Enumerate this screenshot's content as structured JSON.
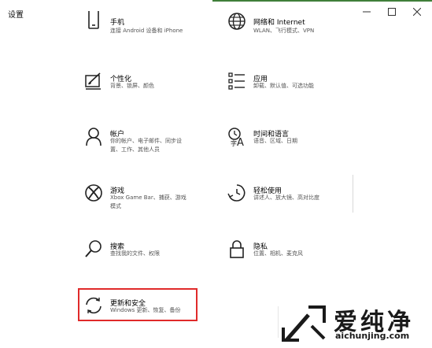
{
  "window": {
    "title": "设置"
  },
  "colors": {
    "highlight_border": "#e02a2a",
    "top_accent": "#3f7f3a"
  },
  "tiles": [
    {
      "id": "phone",
      "icon": "phone-icon",
      "title": "手机",
      "desc": [
        "连接 Android 设备和 iPhone"
      ]
    },
    {
      "id": "network",
      "icon": "globe-icon",
      "title": "网络和 Internet",
      "desc": [
        "WLAN、飞行模式、VPN"
      ]
    },
    {
      "id": "personalization",
      "icon": "paintbrush-icon",
      "title": "个性化",
      "desc": [
        "背景、锁屏、颜色"
      ]
    },
    {
      "id": "apps",
      "icon": "app-list-icon",
      "title": "应用",
      "desc": [
        "卸载、默认值、可选功能"
      ]
    },
    {
      "id": "accounts",
      "icon": "person-icon",
      "title": "帐户",
      "desc": [
        "你的帐户、电子邮件、同步设",
        "置、工作、其他人员"
      ]
    },
    {
      "id": "time",
      "icon": "time-language-icon",
      "title": "时间和语言",
      "desc": [
        "语音、区域、日期"
      ]
    },
    {
      "id": "gaming",
      "icon": "xbox-icon",
      "title": "游戏",
      "desc": [
        "Xbox Game Bar、捕获、游戏",
        "模式"
      ]
    },
    {
      "id": "ease",
      "icon": "ease-of-access-icon",
      "title": "轻松使用",
      "desc": [
        "讲述人、放大镜、高对比度"
      ]
    },
    {
      "id": "search",
      "icon": "search-icon",
      "title": "搜索",
      "desc": [
        "查找我的文件、权限"
      ]
    },
    {
      "id": "privacy",
      "icon": "lock-icon",
      "title": "隐私",
      "desc": [
        "位置、相机、麦克风"
      ]
    },
    {
      "id": "update",
      "icon": "refresh-icon",
      "title": "更新和安全",
      "desc": [
        "Windows 更新、恢复、备份"
      ]
    }
  ],
  "watermark": {
    "text": "爱纯净",
    "url": "aichunjing.com"
  }
}
